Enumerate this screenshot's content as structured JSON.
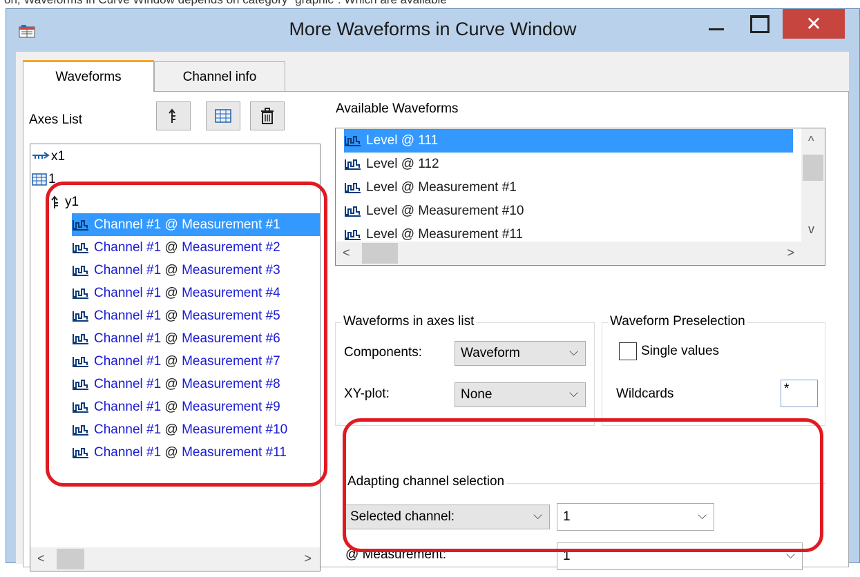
{
  "top_note": "on, Waveforms in Curve Window depends on category \"graphic\". Which are available",
  "window": {
    "title": "More Waveforms in Curve Window"
  },
  "tabs": [
    {
      "label": "Waveforms"
    },
    {
      "label": "Channel info"
    }
  ],
  "axes": {
    "label": "Axes List",
    "tree": [
      {
        "label": "x1",
        "icon": "x-axis-icon"
      },
      {
        "label": "1",
        "icon": "grid-icon"
      },
      {
        "label": "y1",
        "icon": "y-axis-icon"
      }
    ],
    "waveforms": [
      {
        "channel": "Channel #1",
        "at": "@",
        "meas": "Measurement #1",
        "selected": true
      },
      {
        "channel": "Channel #1",
        "at": "@",
        "meas": "Measurement #2"
      },
      {
        "channel": "Channel #1",
        "at": "@",
        "meas": "Measurement #3"
      },
      {
        "channel": "Channel #1",
        "at": "@",
        "meas": "Measurement #4"
      },
      {
        "channel": "Channel #1",
        "at": "@",
        "meas": "Measurement #5"
      },
      {
        "channel": "Channel #1",
        "at": "@",
        "meas": "Measurement #6"
      },
      {
        "channel": "Channel #1",
        "at": "@",
        "meas": "Measurement #7"
      },
      {
        "channel": "Channel #1",
        "at": "@",
        "meas": "Measurement #8"
      },
      {
        "channel": "Channel #1",
        "at": "@",
        "meas": "Measurement #9"
      },
      {
        "channel": "Channel #1",
        "at": "@",
        "meas": "Measurement #10"
      },
      {
        "channel": "Channel #1",
        "at": "@",
        "meas": "Measurement #11"
      }
    ]
  },
  "available": {
    "label": "Available Waveforms",
    "items": [
      {
        "label": "Level @ 111",
        "selected": true
      },
      {
        "label": "Level @ 112"
      },
      {
        "label": "Level @ Measurement #1"
      },
      {
        "label": "Level @ Measurement #10"
      },
      {
        "label": "Level @ Measurement #11"
      }
    ]
  },
  "waveforms_group": {
    "title": "Waveforms in axes list",
    "components_label": "Components:",
    "components_value": "Waveform",
    "xy_label": "XY-plot:",
    "xy_value": "None"
  },
  "preselection": {
    "title": "Waveform Preselection",
    "single_values_label": "Single values",
    "single_values_checked": false,
    "wildcards_label": "Wildcards",
    "wildcards_value": "*"
  },
  "adapting": {
    "title": "Adapting channel selection",
    "channel_mode": "Selected channel:",
    "channel_value": "1",
    "measurement_label": "@ Measurement:",
    "measurement_value": "1"
  },
  "colors": {
    "selection": "#3399ff",
    "highlight": "#e11a22",
    "link_text": "#1a1ad6",
    "close_button": "#c7453f"
  }
}
